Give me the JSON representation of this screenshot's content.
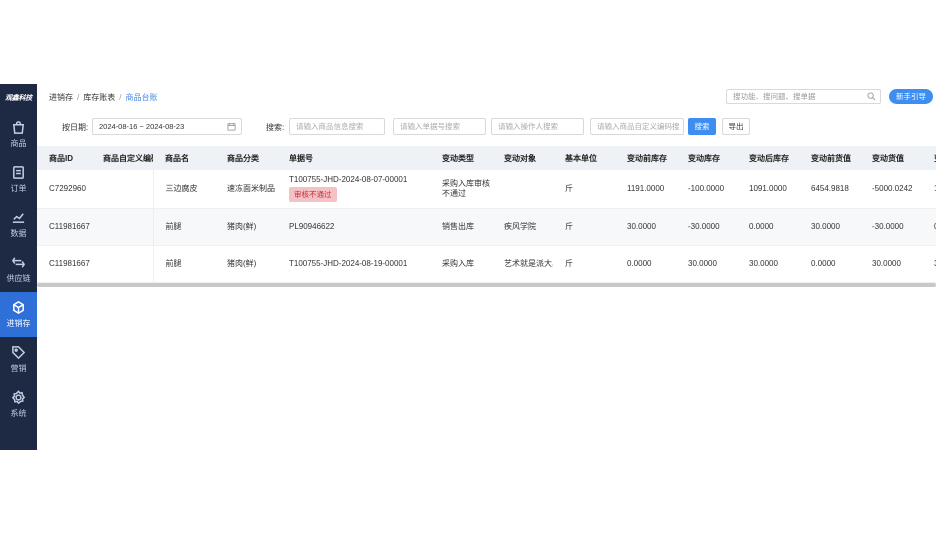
{
  "brand": {
    "logo_text": "观鑫科技"
  },
  "sidebar": {
    "items": [
      {
        "label": "商品",
        "icon": "shopping-bag-icon",
        "active": false
      },
      {
        "label": "订单",
        "icon": "order-document-icon",
        "active": false
      },
      {
        "label": "数据",
        "icon": "line-chart-icon",
        "active": false
      },
      {
        "label": "供应链",
        "icon": "exchange-arrows-icon",
        "active": false
      },
      {
        "label": "进销存",
        "icon": "inventory-box-icon",
        "active": true
      },
      {
        "label": "营销",
        "icon": "tag-icon",
        "active": false
      },
      {
        "label": "系统",
        "icon": "gear-icon",
        "active": false
      }
    ],
    "active_color": "#2e6fd8",
    "bg_color": "#1e2a44"
  },
  "breadcrumb": {
    "items": [
      "进销存",
      "库存账表",
      "商品台账"
    ],
    "separator": "/"
  },
  "header": {
    "search_placeholder": "搜功能、搜问题、搜单据",
    "guide_button": "新手引导"
  },
  "filters": {
    "date_label": "按日期:",
    "date_range": "2024-08-16 ~ 2024-08-23",
    "search_label": "搜索:",
    "product_info_placeholder": "请输入商品信息搜索",
    "bill_no_placeholder": "请输入单据号搜索",
    "operator_placeholder": "请输入操作人搜索",
    "custom_code_placeholder": "请输入商品自定义编码搜",
    "search_button": "搜索",
    "export_button": "导出"
  },
  "table": {
    "columns": [
      "商品ID",
      "商品自定义编码",
      "商品名",
      "商品分类",
      "单据号",
      "变动类型",
      "变动对象",
      "基本单位",
      "变动前库存",
      "变动库存",
      "变动后库存",
      "变动前货值",
      "变动货值",
      "变"
    ],
    "rows": [
      {
        "id": "C7292960",
        "custom_code": "",
        "name": "三边腐皮",
        "category": "速冻面米制品",
        "bill_no": "T100755-JHD-2024-08-07-00001",
        "badge": "审核不通过",
        "change_type": "采购入库审核不通过",
        "target": "",
        "unit": "斤",
        "before_stock": "1191.0000",
        "change_stock": "-100.0000",
        "after_stock": "1091.0000",
        "before_value": "6454.9818",
        "change_value": "-5000.0242",
        "extra": "1"
      },
      {
        "id": "C11981667",
        "custom_code": "",
        "name": "前腿",
        "category": "猪肉(鲜)",
        "bill_no": "PL90946622",
        "badge": "",
        "change_type": "销售出库",
        "target": "疾风学院",
        "unit": "斤",
        "before_stock": "30.0000",
        "change_stock": "-30.0000",
        "after_stock": "0.0000",
        "before_value": "30.0000",
        "change_value": "-30.0000",
        "extra": "0"
      },
      {
        "id": "C11981667",
        "custom_code": "",
        "name": "前腿",
        "category": "猪肉(鲜)",
        "bill_no": "T100755-JHD-2024-08-19-00001",
        "badge": "",
        "change_type": "采购入库",
        "target": "艺术就是派大星",
        "unit": "斤",
        "before_stock": "0.0000",
        "change_stock": "30.0000",
        "after_stock": "30.0000",
        "before_value": "0.0000",
        "change_value": "30.0000",
        "extra": "3"
      }
    ]
  }
}
